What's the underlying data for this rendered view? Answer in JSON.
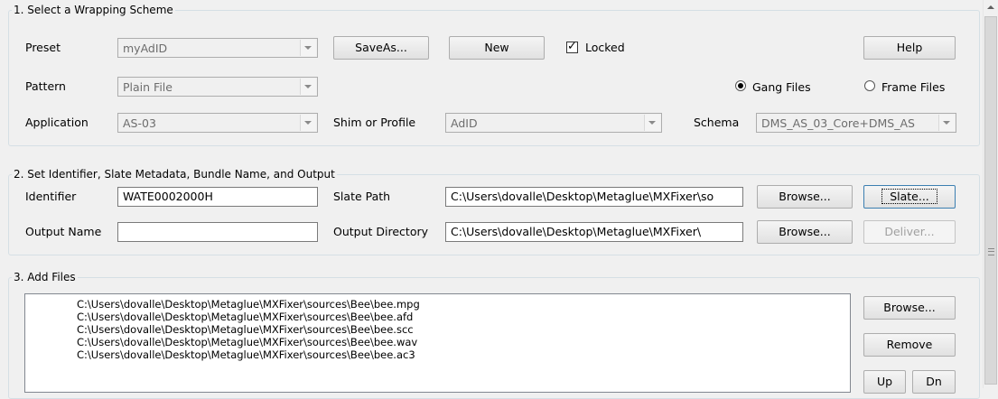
{
  "section1": {
    "legend": "1. Select a Wrapping Scheme",
    "preset": {
      "label": "Preset",
      "value": "myAdID"
    },
    "saveas_button": "SaveAs...",
    "new_button": "New",
    "locked": {
      "label": "Locked",
      "checked": true
    },
    "help_button": "Help",
    "pattern": {
      "label": "Pattern",
      "value": "Plain File"
    },
    "gang_files": {
      "label": "Gang Files",
      "selected": true
    },
    "frame_files": {
      "label": "Frame Files",
      "selected": false
    },
    "application": {
      "label": "Application",
      "value": "AS-03"
    },
    "shim": {
      "label": "Shim or Profile",
      "value": "AdID"
    },
    "schema": {
      "label": "Schema",
      "value": "DMS_AS_03_Core+DMS_AS"
    }
  },
  "section2": {
    "legend": "2. Set Identifier, Slate Metadata, Bundle Name, and Output",
    "identifier": {
      "label": "Identifier",
      "value": "WATE0002000H"
    },
    "slate_path": {
      "label": "Slate Path",
      "value": "C:\\Users\\dovalle\\Desktop\\Metaglue\\MXFixer\\so"
    },
    "browse1_button": "Browse...",
    "slate_button": "Slate...",
    "output_name": {
      "label": "Output Name",
      "value": ""
    },
    "output_directory": {
      "label": "Output Directory",
      "value": "C:\\Users\\dovalle\\Desktop\\Metaglue\\MXFixer\\"
    },
    "browse2_button": "Browse...",
    "deliver_button": "Deliver..."
  },
  "section3": {
    "legend": "3. Add Files",
    "files": [
      "C:\\Users\\dovalle\\Desktop\\Metaglue\\MXFixer\\sources\\Bee\\bee.mpg",
      "C:\\Users\\dovalle\\Desktop\\Metaglue\\MXFixer\\sources\\Bee\\bee.afd",
      "C:\\Users\\dovalle\\Desktop\\Metaglue\\MXFixer\\sources\\Bee\\bee.scc",
      "C:\\Users\\dovalle\\Desktop\\Metaglue\\MXFixer\\sources\\Bee\\bee.wav",
      "C:\\Users\\dovalle\\Desktop\\Metaglue\\MXFixer\\sources\\Bee\\bee.ac3"
    ],
    "browse_button": "Browse...",
    "remove_button": "Remove",
    "up_button": "Up",
    "dn_button": "Dn"
  }
}
